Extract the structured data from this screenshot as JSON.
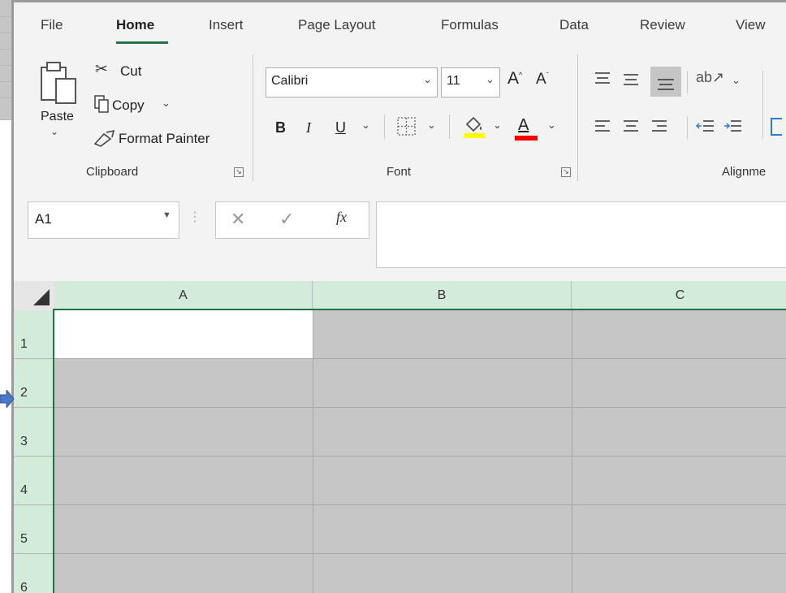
{
  "ribbon_tabs": [
    {
      "label": "File"
    },
    {
      "label": "Home",
      "active": true
    },
    {
      "label": "Insert"
    },
    {
      "label": "Page Layout"
    },
    {
      "label": "Formulas"
    },
    {
      "label": "Data"
    },
    {
      "label": "Review"
    },
    {
      "label": "View"
    }
  ],
  "clipboard": {
    "paste_label": "Paste",
    "cut_label": "Cut",
    "copy_label": "Copy",
    "format_painter_label": "Format Painter",
    "group_label": "Clipboard"
  },
  "font": {
    "font_name": "Calibri",
    "font_size": "11",
    "bold_label": "B",
    "italic_label": "I",
    "underline_label": "U",
    "font_color_label": "A",
    "group_label": "Font",
    "highlight_color": "#ffff00",
    "font_color": "#ff0000"
  },
  "alignment": {
    "group_label": "Alignme"
  },
  "formula_bar": {
    "name_box": "A1",
    "fx_label": "fx",
    "value": ""
  },
  "grid": {
    "columns": [
      "A",
      "B",
      "C"
    ],
    "rows": [
      "1",
      "2",
      "3",
      "4",
      "5",
      "6"
    ],
    "accent": "#217346",
    "header_selected_bg": "#d3ebd9"
  }
}
